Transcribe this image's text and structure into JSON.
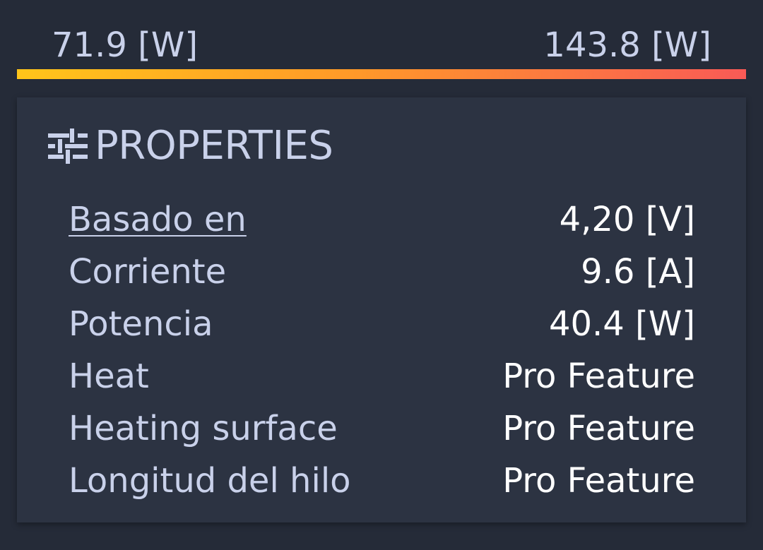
{
  "range": {
    "min_label": "71.9 [W]",
    "max_label": "143.8 [W]"
  },
  "gradient_colors": [
    "#ffc51a",
    "#ff9a28",
    "#f95a56"
  ],
  "card": {
    "icon": "tune-icon",
    "title": "PROPERTIES",
    "rows": [
      {
        "label": "Basado en",
        "value": "4,20 [V]"
      },
      {
        "label": "Corriente",
        "value": "9.6 [A]"
      },
      {
        "label": "Potencia",
        "value": "40.4 [W]"
      },
      {
        "label": "Heat",
        "value": "Pro Feature"
      },
      {
        "label": "Heating surface",
        "value": "Pro Feature"
      },
      {
        "label": "Longitud del hilo",
        "value": "Pro Feature"
      }
    ]
  },
  "colors": {
    "background": "#252b38",
    "card": "#2c3342",
    "label": "#c9d1ea",
    "value": "#ffffff"
  }
}
